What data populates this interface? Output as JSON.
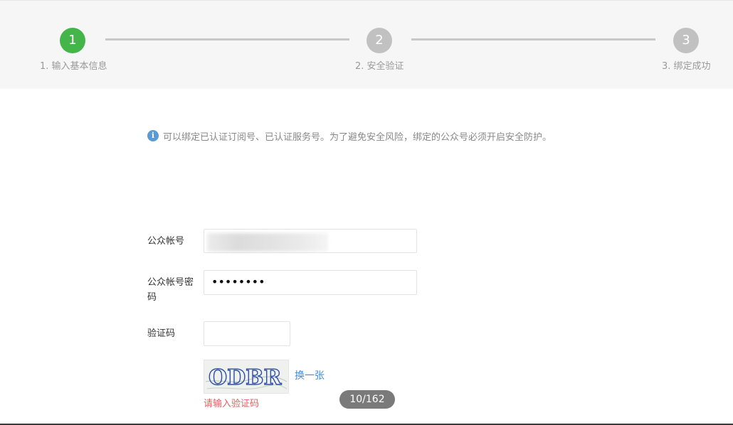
{
  "stepper": {
    "steps": [
      {
        "number": "1",
        "label": "1. 输入基本信息",
        "state": "active"
      },
      {
        "number": "2",
        "label": "2. 安全验证",
        "state": "pending"
      },
      {
        "number": "3",
        "label": "3. 绑定成功",
        "state": "pending"
      }
    ],
    "active_color": "#44b549",
    "idle_color": "#c1c1c1"
  },
  "notice": {
    "icon": "info-icon",
    "icon_glyph": "i",
    "text": "可以绑定已认证订阅号、已认证服务号。为了避免安全风险，绑定的公众号必须开启安全防护。"
  },
  "form": {
    "account_label": "公众帐号",
    "password_label_line1": "公众帐号密",
    "password_label_line2": "码",
    "password_value": "••••••••",
    "captcha_label": "验证码",
    "captcha_value": "",
    "captcha_text": "ODBR",
    "refresh_label": "换一张",
    "error_message": "请输入验证码",
    "error_color": "#e15f5f"
  },
  "viewer": {
    "page_counter": "10/162"
  }
}
